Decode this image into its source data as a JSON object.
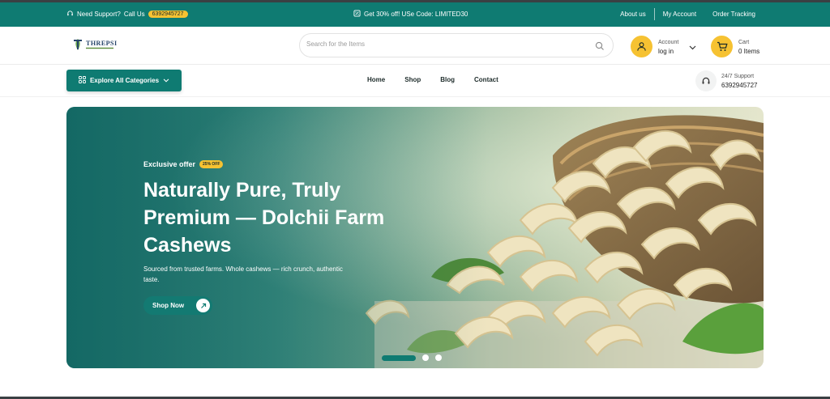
{
  "topbar": {
    "support_label": "Need Support?",
    "call_label": "Call Us",
    "phone": "6392945727",
    "promo": "Get 30% off! USe Code: LIMITED30",
    "links": [
      "About us",
      "My Account",
      "Order Tracking"
    ]
  },
  "header": {
    "logo_text": "THREPSI",
    "search_placeholder": "Search for the Items",
    "account": {
      "label": "Account",
      "value": "log in"
    },
    "cart": {
      "label": "Cart",
      "value": "0 Items"
    }
  },
  "nav": {
    "categories_label": "Explore All Categories",
    "menu": [
      "Home",
      "Shop",
      "Blog",
      "Contact"
    ],
    "support": {
      "label": "24/7 Support",
      "value": "6392945727"
    }
  },
  "hero": {
    "offer_label": "Exclusive offer",
    "offer_badge": "25% OFF",
    "title": "Naturally Pure, Truly Premium — Dolchii Farm Cashews",
    "description": "Sourced from trusted farms. Whole cashews — rich crunch, authentic taste.",
    "button_label": "Shop Now",
    "slides_total": 3,
    "active_slide": 1
  },
  "colors": {
    "brand": "#0f7b72",
    "accent": "#f6c232"
  },
  "icons": [
    "headset-icon",
    "tag-icon",
    "search-icon",
    "user-icon",
    "chevron-down-icon",
    "cart-icon",
    "grid-icon",
    "arrow-up-right-icon"
  ]
}
